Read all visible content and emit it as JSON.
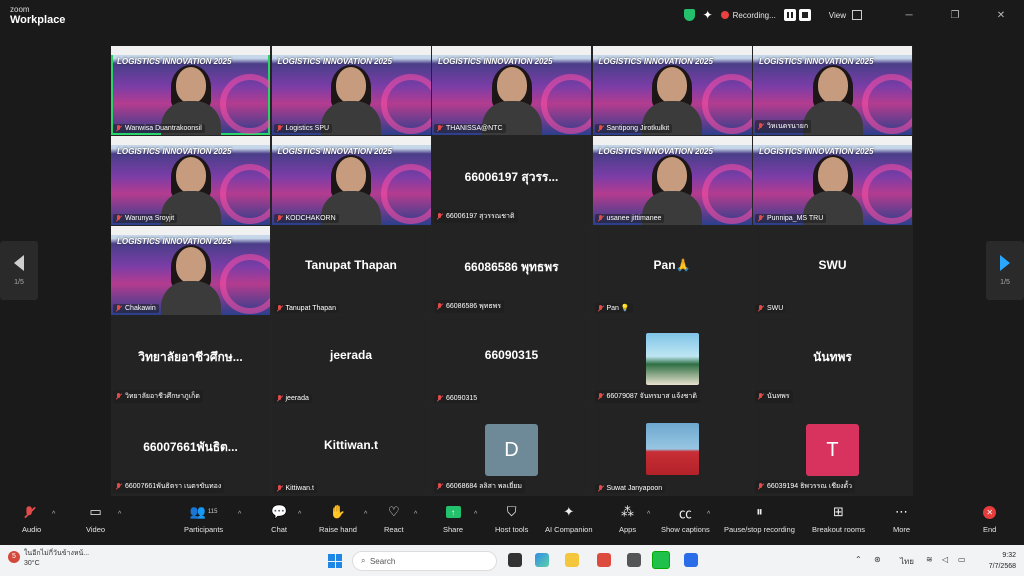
{
  "app": {
    "brand_line1": "zoom",
    "brand_line2": "Workplace"
  },
  "topbar": {
    "recording": "Recording...",
    "view": "View"
  },
  "pager": {
    "left": "1/5",
    "right": "1/5"
  },
  "event_banner": "LOGISTICS INNOVATION 2025",
  "tiles": [
    {
      "name": "Wanwisa Duantrakoonsil",
      "type": "video",
      "active": true
    },
    {
      "name": "Logistics SPU",
      "type": "video"
    },
    {
      "name": "THANISSA@NTC",
      "type": "video"
    },
    {
      "name": "Santipong Jirotkulkit",
      "type": "video"
    },
    {
      "name": "วิหเนตรนายก",
      "type": "video"
    },
    {
      "name": "Warunya Sroyjit",
      "type": "video"
    },
    {
      "name": "KODCHAKORN",
      "type": "video"
    },
    {
      "name": "66006197 สุวรรณชาติ",
      "type": "text",
      "display": "66006197 สุวรร..."
    },
    {
      "name": "usanee jittimanee",
      "type": "video"
    },
    {
      "name": "Punnipa_MS TRU",
      "type": "video"
    },
    {
      "name": "Chakawin",
      "type": "video"
    },
    {
      "name": "Tanupat Thapan",
      "type": "text",
      "display": "Tanupat Thapan"
    },
    {
      "name": "66086586 พุทธพร",
      "type": "text",
      "display": "66086586 พุทธพร"
    },
    {
      "name": "Pan 💡",
      "type": "text",
      "display": "Pan🙏"
    },
    {
      "name": "SWU",
      "type": "text",
      "display": "SWU"
    },
    {
      "name": "วิทยาลัยอาชีวศึกษาภูเก็ต",
      "type": "text",
      "display": "วิทยาลัยอาชีวศึกษ..."
    },
    {
      "name": "jeerada",
      "type": "text",
      "display": "jeerada"
    },
    {
      "name": "66090315",
      "type": "text",
      "display": "66090315"
    },
    {
      "name": "66079087 จันทรมาส แจ้งชาติ",
      "type": "photo"
    },
    {
      "name": "นันทพร",
      "type": "text",
      "display": "นันทพร"
    },
    {
      "name": "66007661พันธิตรา เนตรขันทอง",
      "type": "text",
      "display": "66007661พันธิต..."
    },
    {
      "name": "Kittiwan.t",
      "type": "text",
      "display": "Kittiwan.t"
    },
    {
      "name": "66068684 ลลิสา พลเยี่ยม",
      "type": "avatar",
      "initial": "D",
      "color": "#6e8a99"
    },
    {
      "name": "Suwat Janyapoon",
      "type": "photo2"
    },
    {
      "name": "66039194 ธิพวรรณ เชียงตั้ว",
      "type": "avatar",
      "initial": "T",
      "color": "#d8335f"
    }
  ],
  "toolbar": {
    "audio": "Audio",
    "video": "Video",
    "participants": "Participants",
    "participants_count": "115",
    "chat": "Chat",
    "raise_hand": "Raise hand",
    "react": "React",
    "share": "Share",
    "host_tools": "Host tools",
    "ai_companion": "AI Companion",
    "apps": "Apps",
    "show_captions": "Show captions",
    "pause_stop": "Pause/stop recording",
    "breakout": "Breakout rooms",
    "more": "More",
    "end": "End"
  },
  "taskbar": {
    "notification_count": "5",
    "weather_text": "ในอีกไม่กี่วันข้างหน้...",
    "temperature": "30°C",
    "search": "Search",
    "language": "ไทย",
    "time": "9:32",
    "date": "7/7/2568"
  }
}
